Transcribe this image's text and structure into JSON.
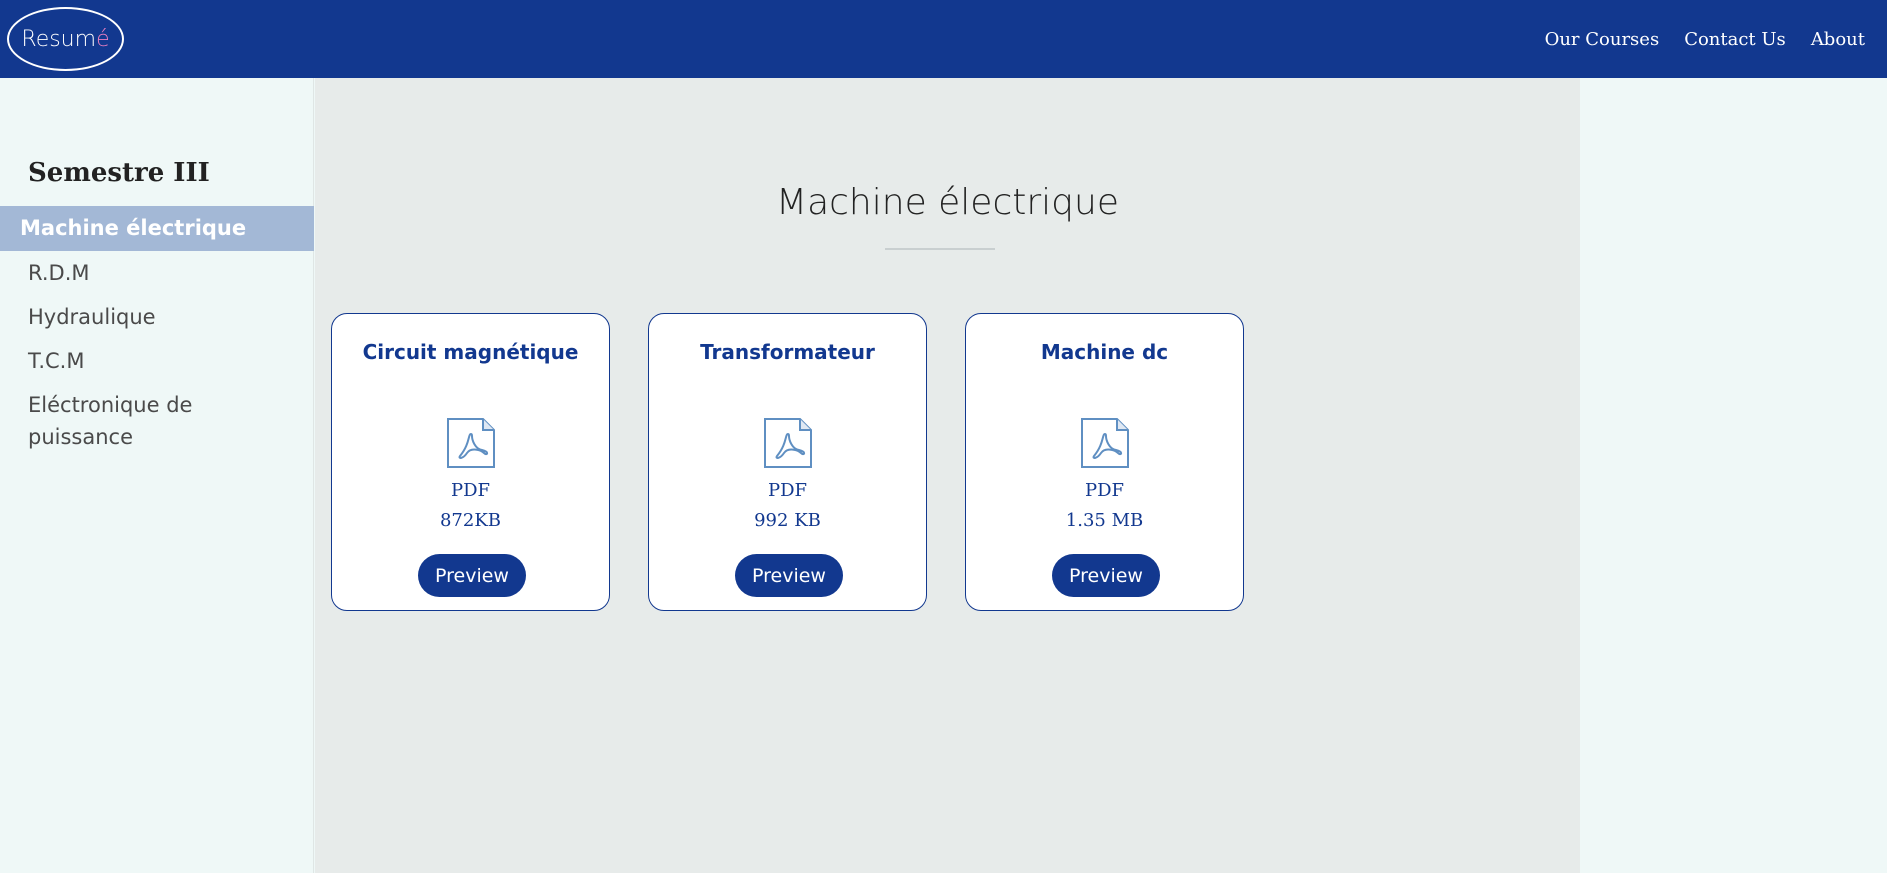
{
  "brand": {
    "logo_text": "Resum",
    "logo_accent": "é",
    "primary_color": "#12388f",
    "accent_color": "#e87fc1"
  },
  "nav": {
    "items": [
      "Our Courses",
      "Contact Us",
      "About"
    ]
  },
  "sidebar": {
    "heading": "Semestre III",
    "items": [
      {
        "label": "Machine électrique",
        "active": true
      },
      {
        "label": "R.D.M",
        "active": false
      },
      {
        "label": "Hydraulique",
        "active": false
      },
      {
        "label": "T.C.M",
        "active": false
      },
      {
        "label": "Eléctronique de puissance",
        "active": false
      }
    ]
  },
  "main": {
    "title": "Machine électrique",
    "cards": [
      {
        "title": "Circuit magnétique",
        "icon": "pdf-file-icon",
        "type": "PDF",
        "size": "872KB",
        "button": "Preview"
      },
      {
        "title": "Transformateur",
        "icon": "pdf-file-icon",
        "type": "PDF",
        "size": "992 KB",
        "button": "Preview"
      },
      {
        "title": "Machine dc",
        "icon": "pdf-file-icon",
        "type": "PDF",
        "size": "1.35 MB",
        "button": "Preview"
      }
    ]
  }
}
